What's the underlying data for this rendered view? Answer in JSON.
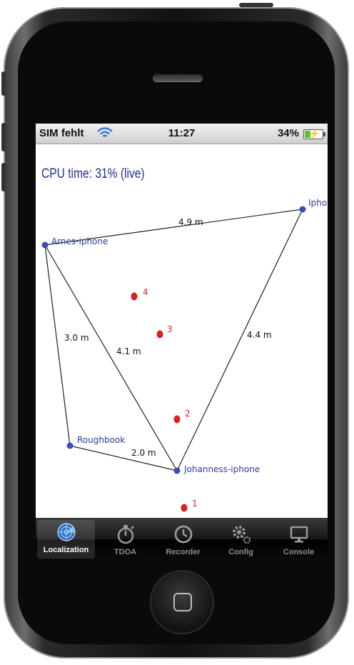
{
  "status_bar": {
    "carrier": "SIM fehlt",
    "time": "11:27",
    "battery_percent": "34%",
    "battery_level": 0.34,
    "wifi_icon": "wifi-icon",
    "battery_icon": "battery-charging-icon"
  },
  "main": {
    "cpu_time": "CPU time:  31% (live)"
  },
  "map": {
    "nodes": [
      {
        "label": "Arnes-iphone"
      },
      {
        "label": "Iphone"
      },
      {
        "label": "Roughbook"
      },
      {
        "label": "Johanness-iphone"
      }
    ],
    "edges": [
      {
        "label": "4.9 m"
      },
      {
        "label": "3.0 m"
      },
      {
        "label": "4.1 m"
      },
      {
        "label": "4.4 m"
      },
      {
        "label": "2.0 m"
      }
    ],
    "targets": [
      {
        "label": "4"
      },
      {
        "label": "3"
      },
      {
        "label": "2"
      },
      {
        "label": "1"
      }
    ],
    "colors": {
      "node": "#3a4fb0",
      "target": "#d92020",
      "edge": "#222222"
    }
  },
  "tabbar": {
    "tabs": [
      {
        "label": "Localization",
        "icon": "radar-icon",
        "active": true
      },
      {
        "label": "TDOA",
        "icon": "stopwatch-icon",
        "active": false
      },
      {
        "label": "Recorder",
        "icon": "clock-icon",
        "active": false
      },
      {
        "label": "Config",
        "icon": "gears-icon",
        "active": false
      },
      {
        "label": "Console",
        "icon": "monitor-icon",
        "active": false
      }
    ]
  }
}
